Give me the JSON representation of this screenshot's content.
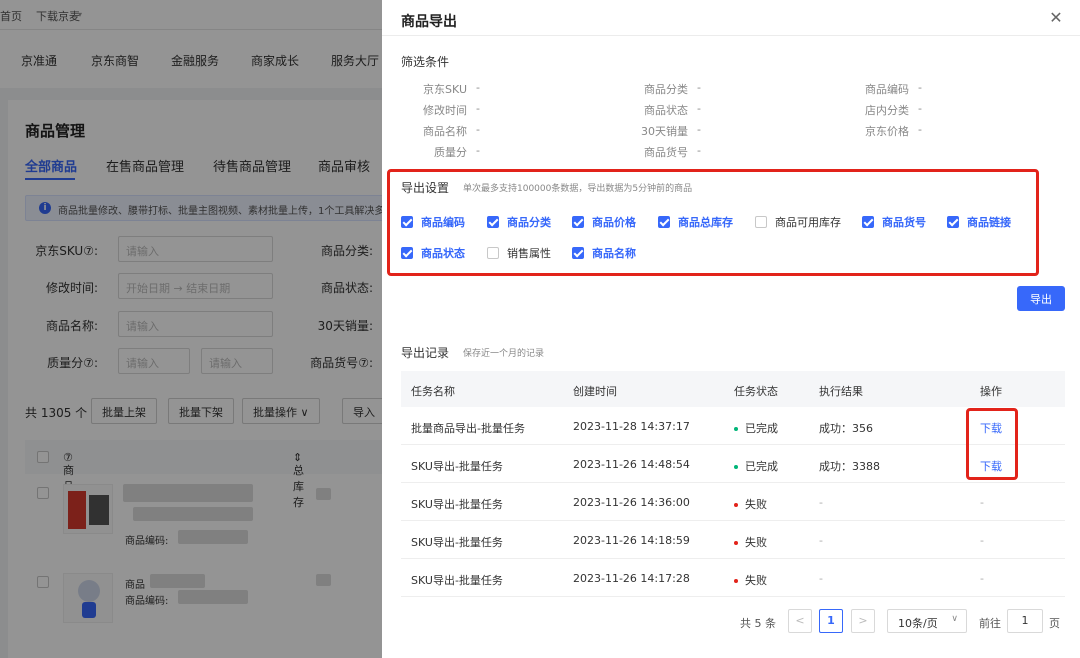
{
  "background": {
    "top_strip": [
      "首页",
      "下载京麦"
    ],
    "nav": [
      "京准通",
      "京东商智",
      "金融服务",
      "商家成长",
      "服务大厅"
    ],
    "page_title": "商品管理",
    "tabs": [
      "全部商品",
      "在售商品管理",
      "待售商品管理",
      "商品审核"
    ],
    "info_text": "商品批量修改、腰带打标、批量主图视频、素材批量上传，1个工具解决多个开",
    "filters": {
      "sku_label": "京东SKU",
      "sku_placeholder": "请输入",
      "mtime_label": "修改时间:",
      "start_date": "开始日期",
      "end_date": "结束日期",
      "name_label": "商品名称:",
      "name_placeholder": "请输入",
      "quality_label": "质量分",
      "quality_placeholder": "请输入",
      "category_label": "商品分类:",
      "status_label": "商品状态:",
      "sales_label": "30天销量:",
      "goods_no_label": "商品货号"
    },
    "count_text": "共 1305 个",
    "buttons": [
      "批量上架",
      "批量下架",
      "批量操作",
      "导入"
    ],
    "table_headers": [
      "商品信息",
      "总库存"
    ],
    "code_label": "商品编码:",
    "row2_label": "商品"
  },
  "drawer": {
    "title": "商品导出",
    "filter_section": "筛选条件",
    "filters": [
      {
        "label": "京东SKU",
        "value": "-"
      },
      {
        "label": "商品分类",
        "value": "-"
      },
      {
        "label": "商品编码",
        "value": "-"
      },
      {
        "label": "修改时间",
        "value": "-"
      },
      {
        "label": "商品状态",
        "value": "-"
      },
      {
        "label": "店内分类",
        "value": "-"
      },
      {
        "label": "商品名称",
        "value": "-"
      },
      {
        "label": "30天销量",
        "value": "-"
      },
      {
        "label": "京东价格",
        "value": "-"
      },
      {
        "label": "质量分",
        "value": "-"
      },
      {
        "label": "商品货号",
        "value": "-"
      }
    ],
    "export_settings": {
      "title": "导出设置",
      "note": "单次最多支持100000条数据，导出数据为5分钟前的商品",
      "options": [
        {
          "label": "商品编码",
          "checked": true
        },
        {
          "label": "商品分类",
          "checked": true
        },
        {
          "label": "商品价格",
          "checked": true
        },
        {
          "label": "商品总库存",
          "checked": true
        },
        {
          "label": "商品可用库存",
          "checked": false
        },
        {
          "label": "商品货号",
          "checked": true
        },
        {
          "label": "商品链接",
          "checked": true
        },
        {
          "label": "商品状态",
          "checked": true
        },
        {
          "label": "销售属性",
          "checked": false
        },
        {
          "label": "商品名称",
          "checked": true
        }
      ]
    },
    "export_button": "导出",
    "records": {
      "title": "导出记录",
      "note": "保存近一个月的记录",
      "headers": [
        "任务名称",
        "创建时间",
        "任务状态",
        "执行结果",
        "操作"
      ],
      "rows": [
        {
          "name": "批量商品导出-批量任务",
          "time": "2023-11-28 14:37:17",
          "status": "已完成",
          "ok": true,
          "result": "成功：356",
          "action": "下载"
        },
        {
          "name": "SKU导出-批量任务",
          "time": "2023-11-26 14:48:54",
          "status": "已完成",
          "ok": true,
          "result": "成功：3388",
          "action": "下载"
        },
        {
          "name": "SKU导出-批量任务",
          "time": "2023-11-26 14:36:00",
          "status": "失败",
          "ok": false,
          "result": "-",
          "action": "-"
        },
        {
          "name": "SKU导出-批量任务",
          "time": "2023-11-26 14:18:59",
          "status": "失败",
          "ok": false,
          "result": "-",
          "action": "-"
        },
        {
          "name": "SKU导出-批量任务",
          "time": "2023-11-26 14:17:28",
          "status": "失败",
          "ok": false,
          "result": "-",
          "action": "-"
        }
      ]
    },
    "pagination": {
      "total": "共 5 条",
      "prev": "<",
      "current": "1",
      "next": ">",
      "page_size": "10条/页",
      "goto_label": "前往",
      "goto_value": "1",
      "page_unit": "页"
    }
  }
}
